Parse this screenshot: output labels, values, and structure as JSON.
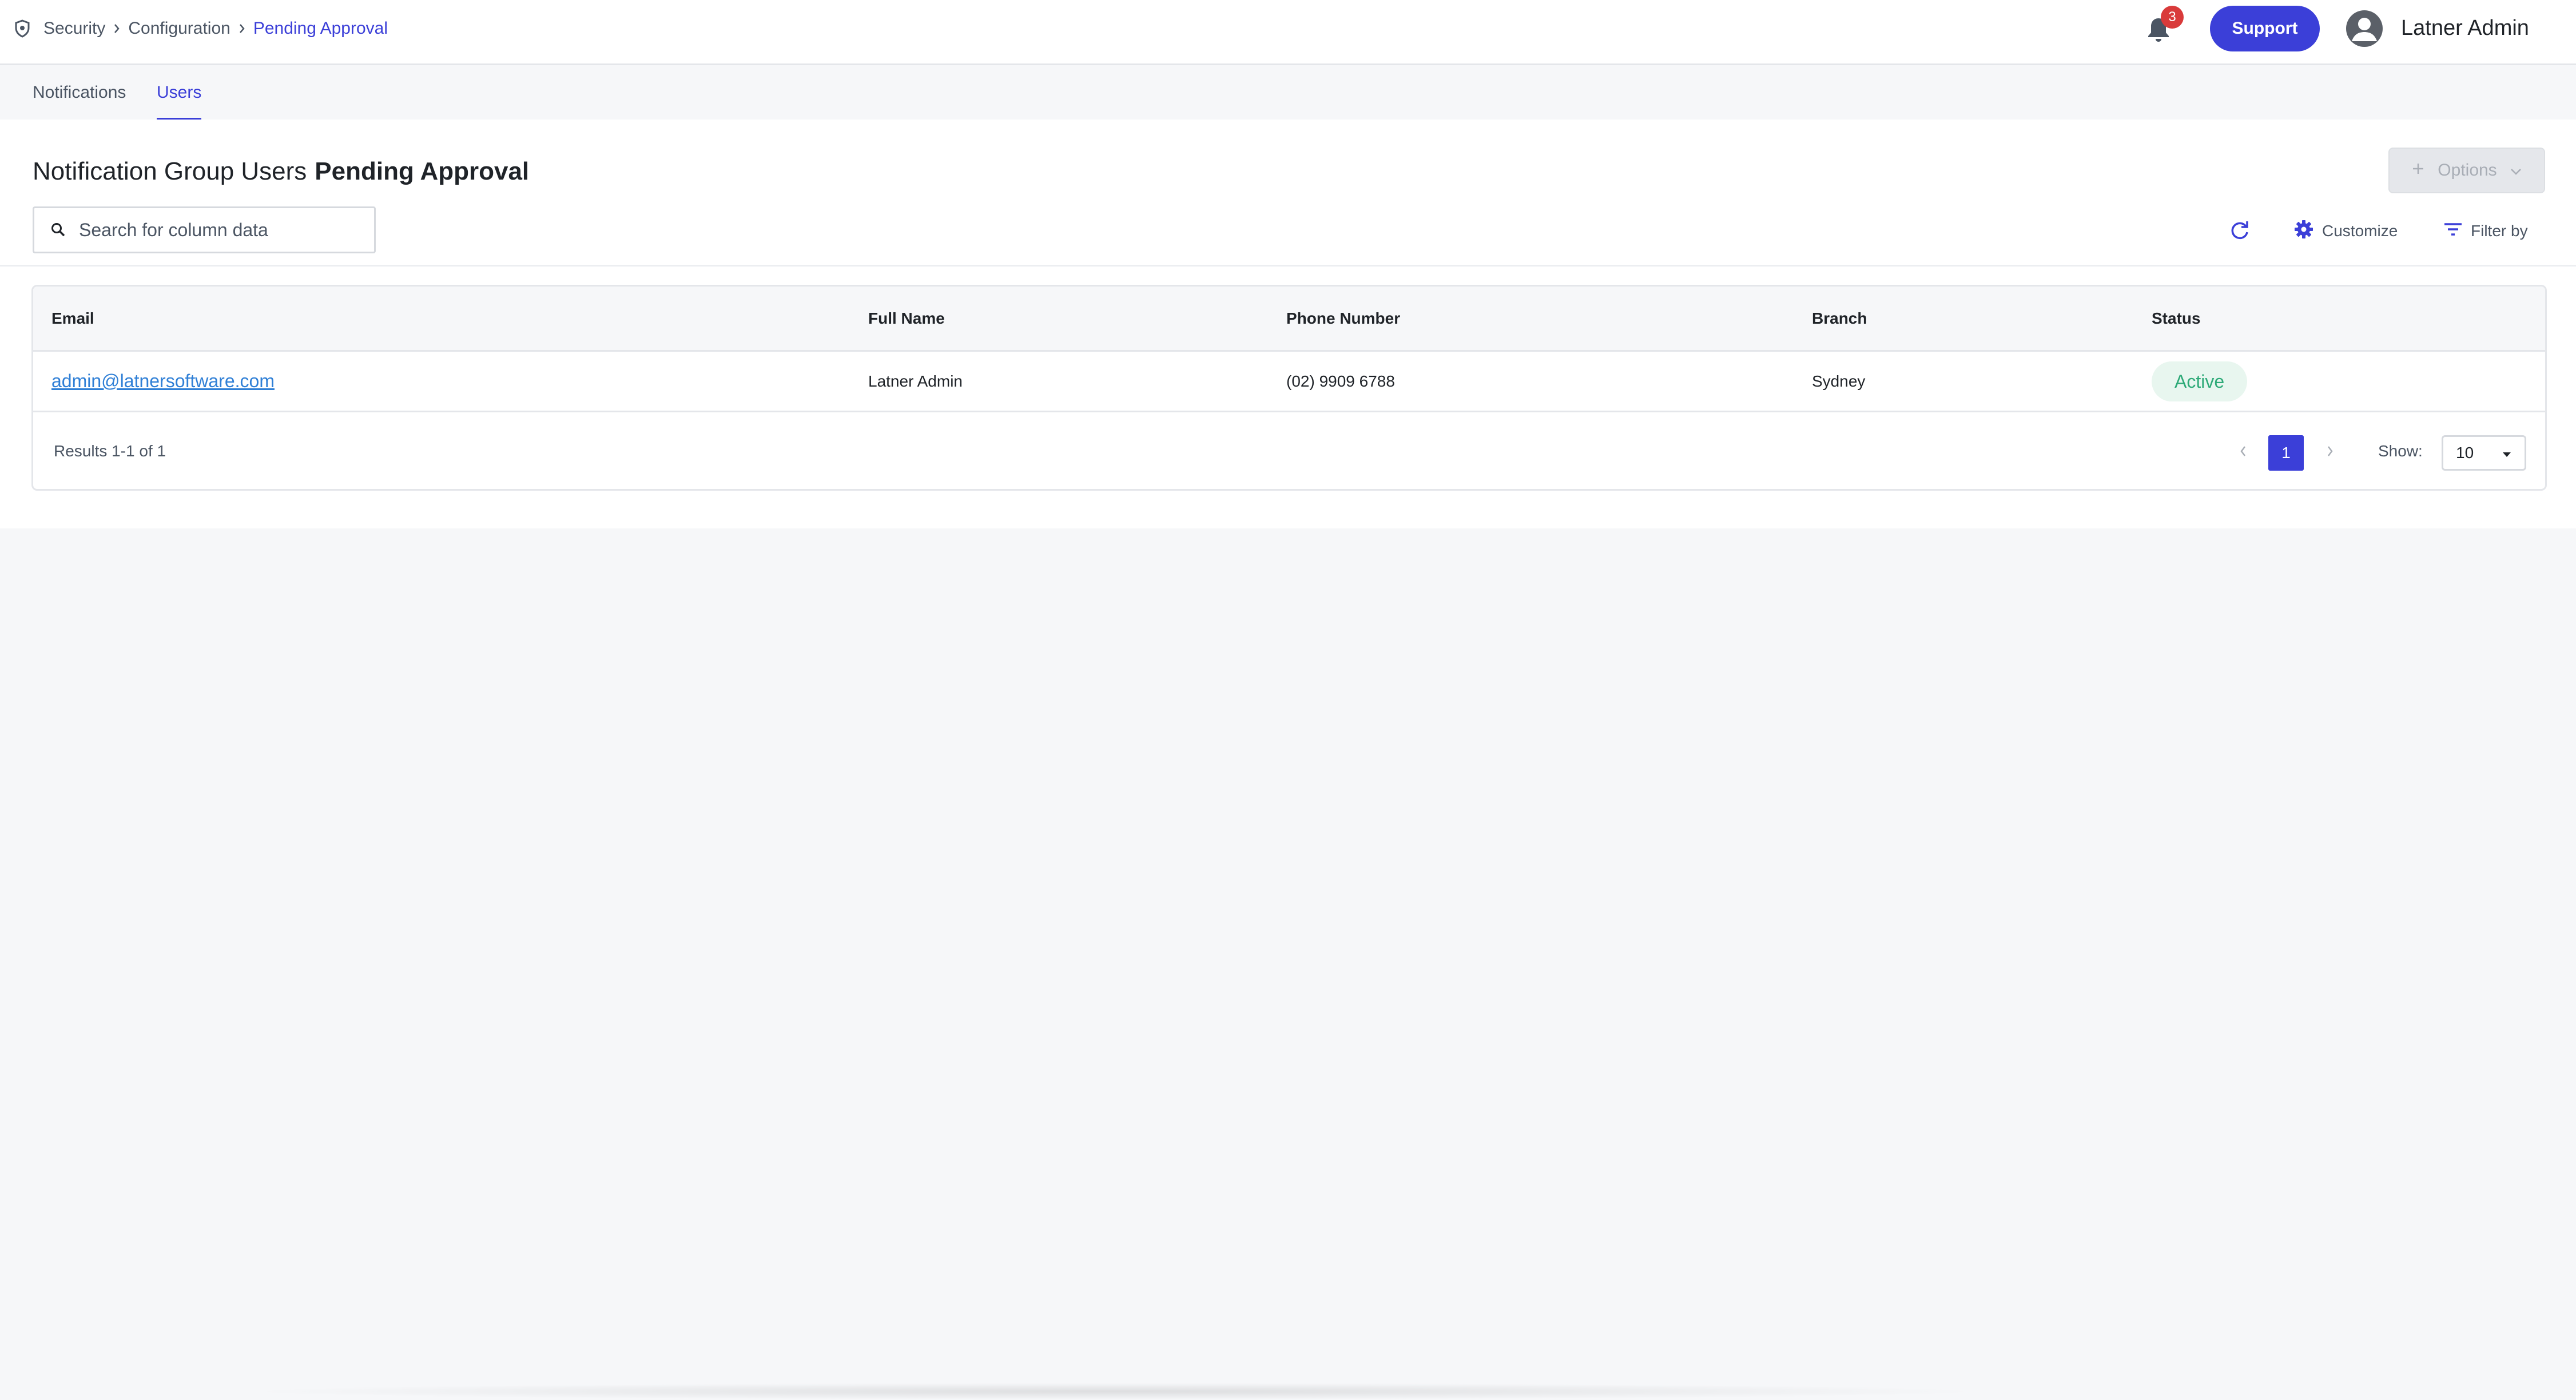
{
  "breadcrumb": {
    "items": [
      {
        "label": "Security"
      },
      {
        "label": "Configuration"
      },
      {
        "label": "Pending Approval"
      }
    ]
  },
  "header": {
    "notification_count": "3",
    "support_label": "Support",
    "user_name": "Latner Admin"
  },
  "tabs": [
    {
      "label": "Notifications",
      "active": false
    },
    {
      "label": "Users",
      "active": true
    }
  ],
  "page": {
    "title": "Notification Group Users",
    "title_emphasis": "Pending Approval",
    "options_label": "Options"
  },
  "search": {
    "placeholder": "Search for column data",
    "value": ""
  },
  "toolbar": {
    "customize_label": "Customize",
    "filter_label": "Filter by"
  },
  "table": {
    "columns": [
      "Email",
      "Full Name",
      "Phone Number",
      "Branch",
      "Status"
    ],
    "rows": [
      {
        "email": "admin@latnersoftware.com",
        "full_name": "Latner Admin",
        "phone": "(02) 9909 6788",
        "branch": "Sydney",
        "status": "Active"
      }
    ],
    "results_text": "Results 1-1 of 1",
    "current_page": "1",
    "show_label": "Show:",
    "page_size": "10"
  },
  "colors": {
    "accent": "#3b3fd8",
    "badge_red": "#d93a3a",
    "link": "#2f7fd6",
    "status_active_text": "#2eaa78",
    "status_active_bg": "#e8f6ef"
  },
  "icons": [
    "shield-icon",
    "chevron-right-icon",
    "bell-icon",
    "user-avatar-icon",
    "plus-icon",
    "chevron-down-icon",
    "search-icon",
    "refresh-icon",
    "gear-icon",
    "filter-icon",
    "chevron-left-icon",
    "caret-down-icon"
  ]
}
